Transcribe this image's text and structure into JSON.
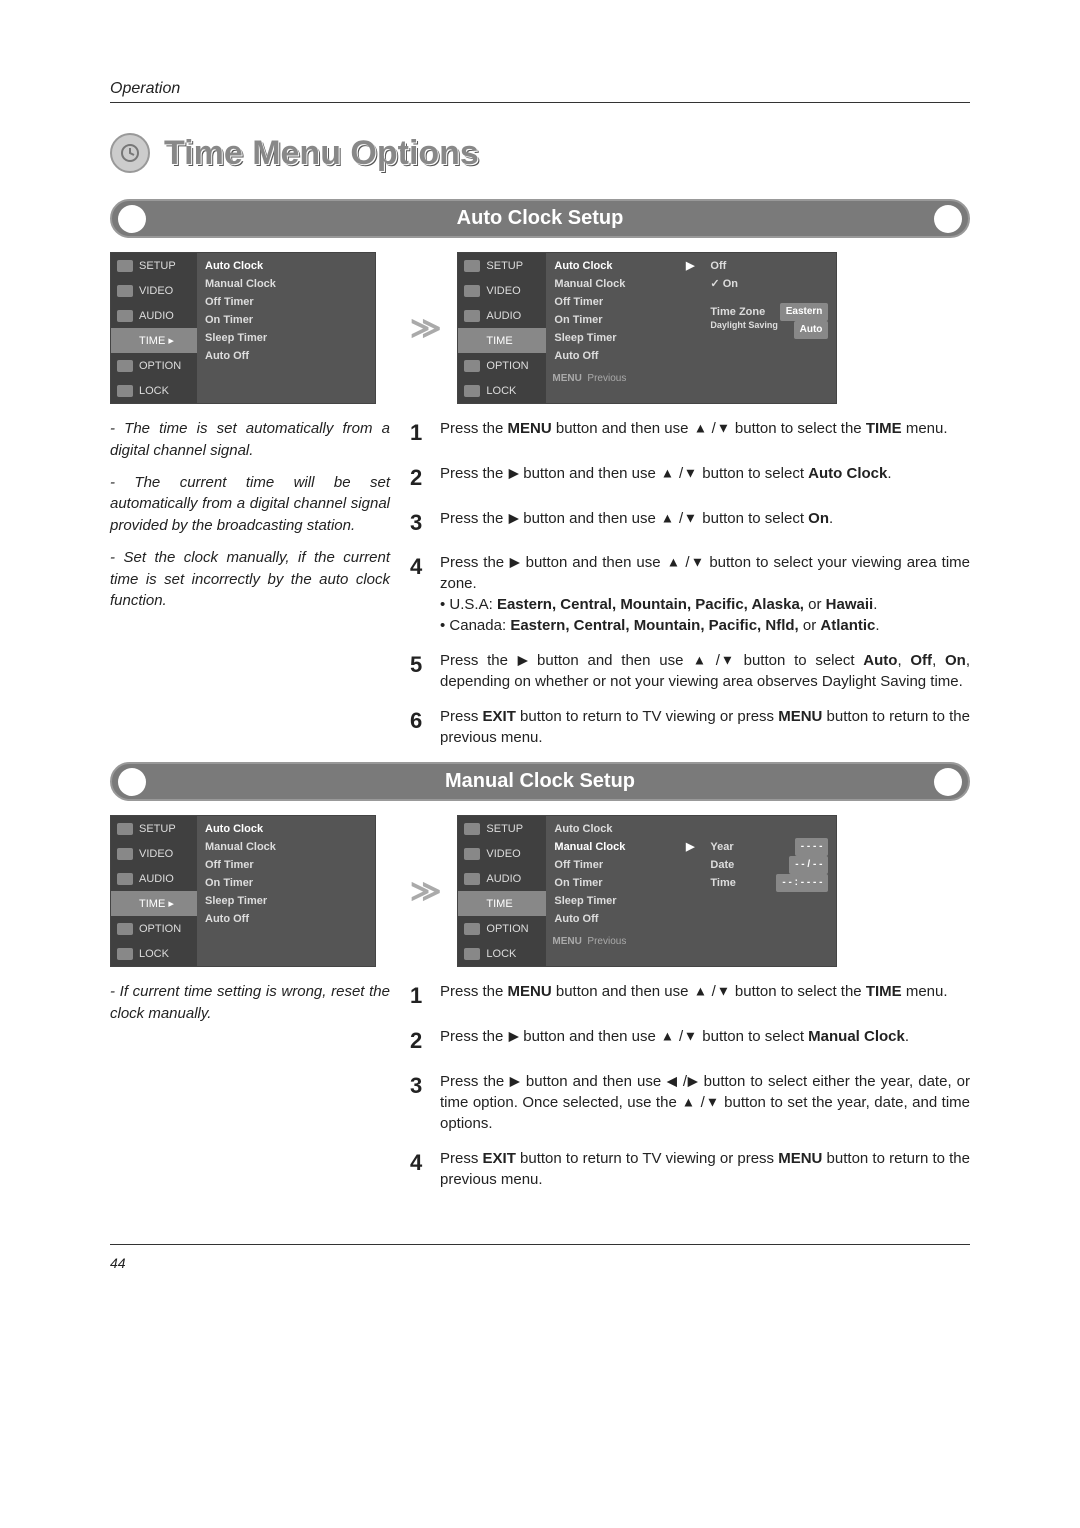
{
  "header": {
    "section": "Operation"
  },
  "title": "Time Menu Options",
  "pageNumber": "44",
  "sections": [
    {
      "title": "Auto Clock Setup"
    },
    {
      "title": "Manual Clock Setup"
    }
  ],
  "osd_sidebar": [
    "SETUP",
    "VIDEO",
    "AUDIO",
    "TIME",
    "OPTION",
    "LOCK"
  ],
  "osd_time_items": [
    "Auto Clock",
    "Manual Clock",
    "Off Timer",
    "On Timer",
    "Sleep Timer",
    "Auto Off"
  ],
  "osd_foot": {
    "menu": "MENU",
    "prev": "Previous"
  },
  "auto_status": {
    "off": "Off",
    "on": "On",
    "tz_label": "Time Zone",
    "tz_value": "Eastern",
    "ds_label": "Daylight Saving",
    "ds_value": "Auto"
  },
  "manual_status": {
    "year_label": "Year",
    "year_value": "- - - -",
    "date_label": "Date",
    "date_value": "- -  /  - -",
    "time_label": "Time",
    "time_value": "- -  :  - -   - -"
  },
  "auto_notes": [
    "- The time is set automatically from a digital channel signal.",
    "- The current time will be set automatically from a digital channel signal provided by the broadcasting station.",
    "- Set the clock manually, if the current time is set incorrectly by the auto clock function."
  ],
  "manual_notes": [
    "- If current time setting is wrong, reset the clock manually."
  ],
  "auto_steps": {
    "s1": {
      "pre": "Press the ",
      "menu": "MENU",
      "mid": " button and then use ",
      "post": " button to select the ",
      "bold": "TIME",
      "tail": " menu."
    },
    "s2": {
      "pre": "Press the ",
      "mid": " button and then use ",
      "post": " button to select ",
      "bold": "Auto Clock",
      "tail": "."
    },
    "s3": {
      "pre": "Press the ",
      "mid": " button and then use ",
      "post": " button to select ",
      "bold": "On",
      "tail": "."
    },
    "s4": {
      "pre": "Press the ",
      "mid": " button and then use ",
      "post": " button to select your viewing area time zone.",
      "usa_pre": "• U.S.A: ",
      "usa_bold": "Eastern, Central, Mountain, Pacific, Alaska,",
      "usa_or": " or ",
      "usa_last": "Hawaii",
      "usa_end": ".",
      "can_pre": "• Canada: ",
      "can_bold": "Eastern, Central, Mountain, Pacific, Nfld,",
      "can_or": " or ",
      "can_last": "Atlantic",
      "can_end": "."
    },
    "s5": {
      "pre": "Press the ",
      "mid": " button and then use ",
      "post": " button to select ",
      "b1": "Auto",
      "c": ", ",
      "b2": "Off",
      "b3": "On",
      "tail": ", depending on whether or not your viewing area observes Daylight Saving time."
    },
    "s6": {
      "pre": "Press ",
      "b1": "EXIT",
      "mid": " button to return to TV viewing or press ",
      "b2": "MENU",
      "tail": " button to return to the previous menu."
    }
  },
  "manual_steps": {
    "s1": {
      "pre": "Press the ",
      "menu": "MENU",
      "mid": " button and then use ",
      "post": " button to select the ",
      "bold": "TIME",
      "tail": " menu."
    },
    "s2": {
      "pre": "Press the ",
      "mid": " button and then use ",
      "post": " button to select ",
      "bold": "Manual Clock",
      "tail": "."
    },
    "s3": {
      "pre": "Press the ",
      "mid": " button and then use ",
      "post": " button to select either the year, date, or time option. Once selected, use the ",
      "post2": " button to set the year, date, and time options."
    },
    "s4": {
      "pre": "Press ",
      "b1": "EXIT",
      "mid": " button to return to TV viewing or press ",
      "b2": "MENU",
      "tail": " button to return to the previous menu."
    }
  }
}
